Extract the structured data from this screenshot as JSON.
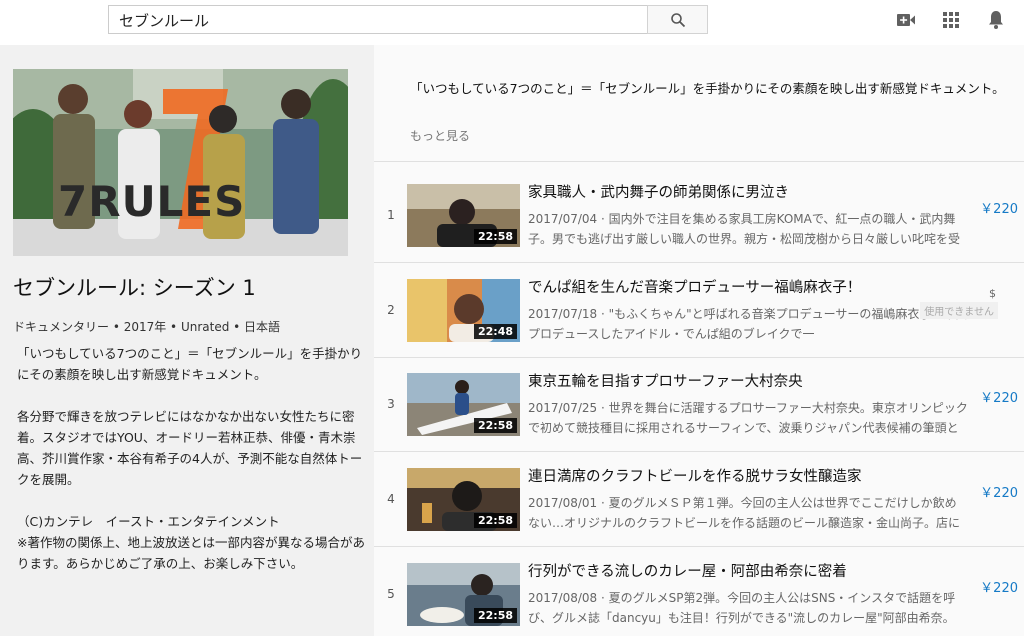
{
  "search": {
    "query": "セブンルール"
  },
  "icons": {
    "search": "search-icon",
    "upload": "video-camera-icon",
    "apps": "apps-grid-icon",
    "notifications": "bell-icon"
  },
  "show": {
    "hero_logo": "7RULES",
    "title": "セブンルール: シーズン 1",
    "meta": "ドキュメンタリー • 2017年 • Unrated • 日本語",
    "description": "「いつもしている7つのこと」＝「セブンルール」を手掛かりにその素顔を映し出す新感覚ドキュメント。\n\n各分野で輝きを放つテレビにはなかなか出ない女性たちに密着。スタジオではYOU、オードリー若林正恭、俳優・青木崇高、芥川賞作家・本谷有希子の4人が、予測不能な自然体トークを展開。\n\n（C)カンテレ　イースト・エンタテインメント\n※著作物の関係上、地上波放送とは一部内容が異なる場合があります。あらかじめご了承の上、お楽しみ下さい。"
  },
  "summary": {
    "text": "「いつもしている7つのこと」＝「セブンルール」を手掛かりにその素顔を映し出す新感覚ドキュメント。",
    "more_label": "もっと見る"
  },
  "colors": {
    "price": "#167ac6",
    "duration_bg": "#000000"
  },
  "episodes": [
    {
      "num": "1",
      "title": "家具職人・武内舞子の師弟関係に男泣き",
      "duration": "22:58",
      "desc": "2017/07/04 · 国内外で注目を集める家具工房KOMAで、紅一点の職人・武内舞子。男でも逃げ出す厳しい職人の世界。親方・松岡茂樹から日々厳しい叱咤を受",
      "price": "￥220"
    },
    {
      "num": "2",
      "title": "でんぱ組を生んだ音楽プロデューサー福嶋麻衣子！",
      "duration": "22:48",
      "desc": "2017/07/18 · \"もふくちゃん\"と呼ばれる音楽プロデューサーの福嶋麻衣子。楽曲プロデュースしたアイドル・でんぱ組のブレイクで一",
      "unavailable_symbol": "$",
      "unavailable_label": "使用できません"
    },
    {
      "num": "3",
      "title": "東京五輪を目指すプロサーファー大村奈央",
      "duration": "22:58",
      "desc": "2017/07/25 · 世界を舞台に活躍するプロサーファー大村奈央。東京オリンピックで初めて競技種目に採用されるサーフィンで、波乗りジャパン代表候補の筆頭と",
      "price": "￥220"
    },
    {
      "num": "4",
      "title": "連日満席のクラフトビールを作る脱サラ女性醸造家",
      "duration": "22:58",
      "desc": "2017/08/01 · 夏のグルメＳＰ第１弾。今回の主人公は世界でここだけしか飲めない…オリジナルのクラフトビールを作る話題のビール醸造家・金山尚子。店に併",
      "price": "￥220"
    },
    {
      "num": "5",
      "title": "行列ができる流しのカレー屋・阿部由希奈に密着",
      "duration": "22:58",
      "desc": "2017/08/08 · 夏のグルメSP第2弾。今回の主人公はSNS・インスタで話題を呼び、グルメ誌「dancyu」も注目！行列ができる\"流しのカレー屋\"阿部由希奈。",
      "price": "￥220"
    }
  ]
}
